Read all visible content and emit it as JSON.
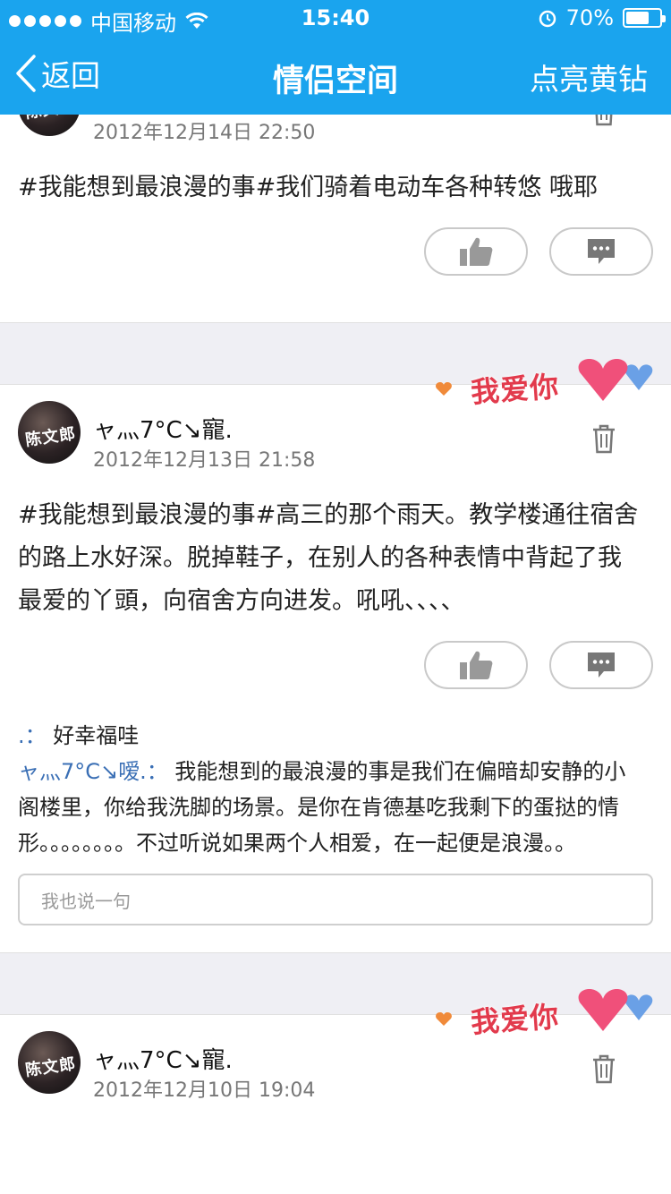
{
  "status_bar": {
    "carrier": "中国移动",
    "time": "15:40",
    "battery_percent": "70%",
    "battery_level": 0.7
  },
  "nav": {
    "back_label": "返回",
    "title": "情侣空间",
    "right_label": "点亮黄钻"
  },
  "stamp_text": "我爱你",
  "posts": [
    {
      "date": "2012年12月14日 22:50",
      "text": "#我能想到最浪漫的事#我们骑着电动车各种转悠 哦耶"
    },
    {
      "username": "ャ灬7°C↘寵.",
      "date": "2012年12月13日 21:58",
      "text": "#我能想到最浪漫的事#高三的那个雨天。教学楼通往宿舍的路上水好深。脱掉鞋子，在别人的各种表情中背起了我最爱的丫頭，向宿舍方向进发。吼吼、、、、",
      "comments": [
        {
          "name": ".：",
          "text": "好幸福哇"
        },
        {
          "name": "ャ灬7°C↘嗳.：",
          "text": "我能想到的最浪漫的事是我们在偏暗却安静的小阁楼里，你给我洗脚的场景。是你在肯德基吃我剩下的蛋挞的情形。。。。。。。。不过听说如果两个人相爱，在一起便是浪漫。。"
        }
      ],
      "reply_placeholder": "我也说一句"
    },
    {
      "username": "ャ灬7°C↘寵.",
      "date": "2012年12月10日 19:04"
    }
  ],
  "colors": {
    "accent": "#1aa4ee",
    "commenter_name": "#3a6fb5",
    "divider_gap": "#efeff4"
  },
  "icons": [
    "back-chevron-icon",
    "wifi-icon",
    "alarm-icon",
    "battery-icon",
    "trash-icon",
    "thumbs-up-icon",
    "comment-icon",
    "heart-icon"
  ]
}
